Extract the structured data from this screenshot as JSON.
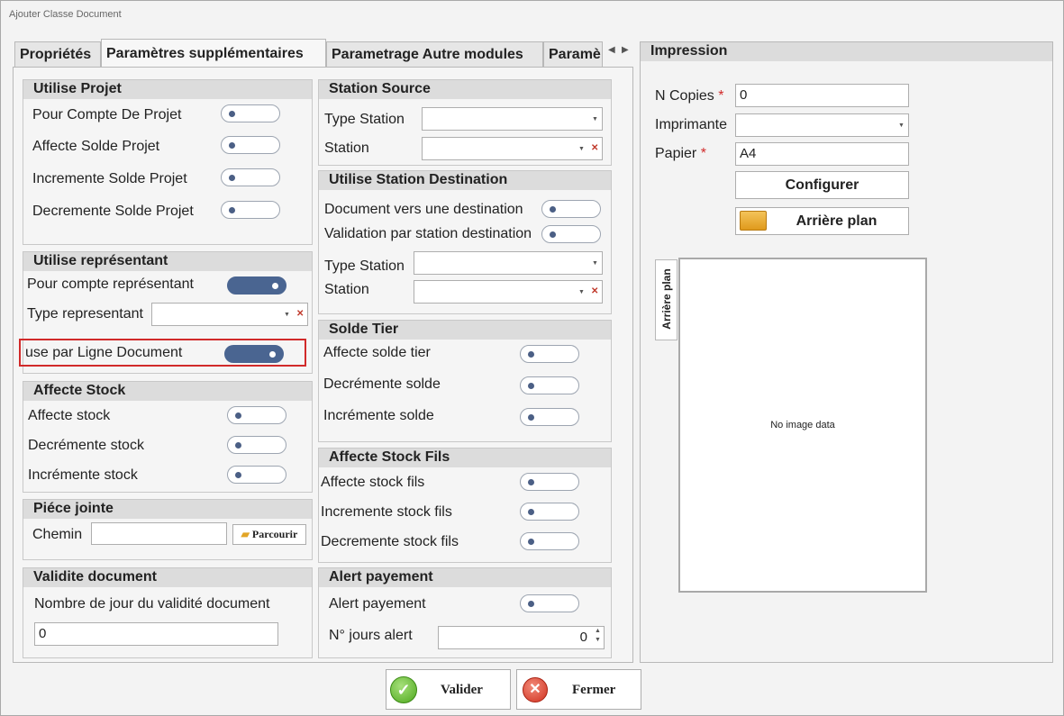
{
  "window": {
    "title": "Ajouter Classe Document"
  },
  "tabs": {
    "items": [
      {
        "label": "Propriétés"
      },
      {
        "label": "Paramètres supplémentaires"
      },
      {
        "label": "Parametrage Autre modules"
      },
      {
        "label": "Paramè"
      }
    ],
    "active": "Paramètres supplémentaires"
  },
  "utilise_projet": {
    "title": "Utilise Projet",
    "items": [
      {
        "label": "Pour Compte De Projet",
        "on": false
      },
      {
        "label": "Affecte Solde Projet",
        "on": false
      },
      {
        "label": "Incremente Solde Projet",
        "on": false
      },
      {
        "label": "Decremente Solde Projet",
        "on": false
      }
    ]
  },
  "representant": {
    "title": "Utilise représentant",
    "pour_compte": {
      "label": "Pour compte représentant",
      "on": true
    },
    "type_label": "Type representant",
    "type_value": "",
    "ligne_document": {
      "label": "use par Ligne Document",
      "on": true
    }
  },
  "affecte_stock": {
    "title": "Affecte Stock",
    "items": [
      {
        "label": "Affecte stock",
        "on": false
      },
      {
        "label": "Decrémente stock",
        "on": false
      },
      {
        "label": "Incrémente stock",
        "on": false
      }
    ]
  },
  "piece_jointe": {
    "title": "Piéce jointe",
    "chemin_label": "Chemin",
    "chemin_value": "",
    "browse_label": "Parcourir"
  },
  "validite": {
    "title": "Validite document",
    "label": "Nombre de jour du validité document",
    "value": "0"
  },
  "station_source": {
    "title": "Station Source",
    "type_label": "Type Station",
    "station_label": "Station"
  },
  "station_dest": {
    "title": "Utilise Station Destination",
    "doc_dest": {
      "label": "Document vers une destination",
      "on": false
    },
    "validation": {
      "label": "Validation par station destination",
      "on": false
    },
    "type_label": "Type Station",
    "station_label": "Station"
  },
  "solde_tier": {
    "title": "Solde Tier",
    "items": [
      {
        "label": "Affecte solde tier",
        "on": false
      },
      {
        "label": "Decrémente solde",
        "on": false
      },
      {
        "label": "Incrémente solde",
        "on": false
      }
    ]
  },
  "stock_fils": {
    "title": "Affecte Stock Fils",
    "items": [
      {
        "label": "Affecte stock fils",
        "on": false
      },
      {
        "label": "Incremente stock fils",
        "on": false
      },
      {
        "label": "Decremente stock fils",
        "on": false
      }
    ]
  },
  "alert": {
    "title": "Alert payement",
    "toggle": {
      "label": "Alert payement",
      "on": false
    },
    "jours_label": "N° jours alert",
    "jours_value": "0"
  },
  "impression": {
    "title": "Impression",
    "copies_label": "N Copies",
    "copies_value": "0",
    "imprimante_label": "Imprimante",
    "imprimante_value": "",
    "papier_label": "Papier",
    "papier_value": "A4",
    "required_mark": "*",
    "configurer_label": "Configurer",
    "arriere_label": "Arrière plan",
    "side_tab_label": "Arrière plan",
    "no_image_label": "No image data"
  },
  "footer": {
    "valider_label": "Valider",
    "fermer_label": "Fermer"
  },
  "colors": {
    "toggle_on": "#4a6591",
    "highlight": "#d12a2a",
    "valider_icon": "#5cb82a",
    "fermer_icon": "#d8402f"
  }
}
